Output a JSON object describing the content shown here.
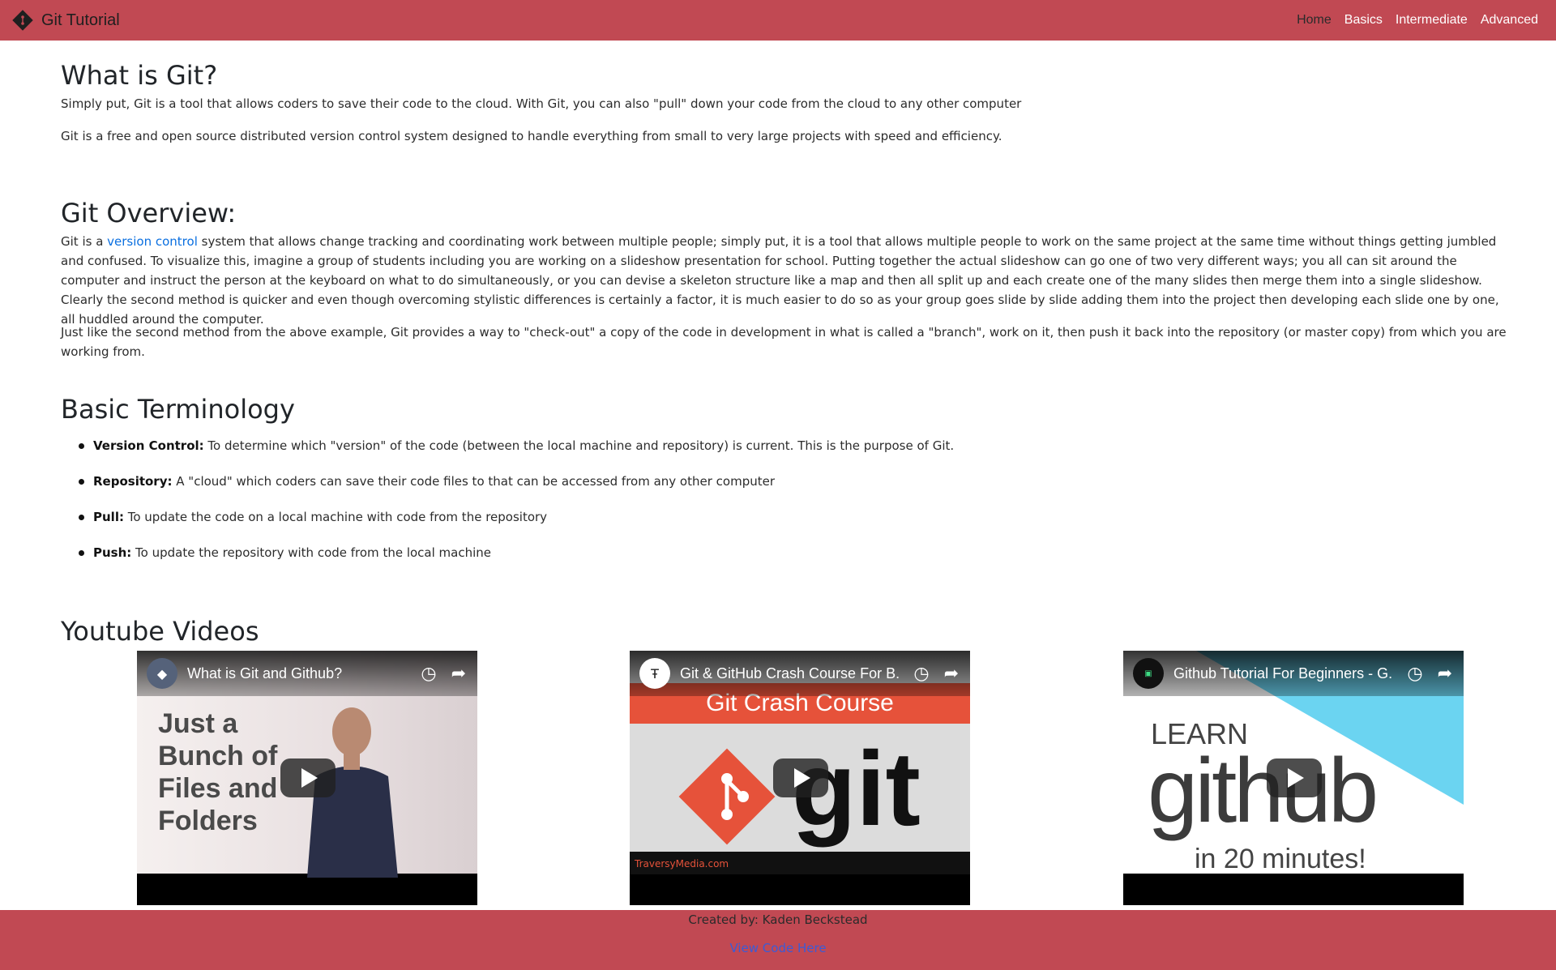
{
  "nav": {
    "brand": "Git Tutorial",
    "links": [
      "Home",
      "Basics",
      "Intermediate",
      "Advanced"
    ]
  },
  "section1": {
    "title": "What is Git?",
    "p1": "Simply put, Git is a tool that allows coders to save their code to the cloud. With Git, you can also \"pull\" down your code from the cloud to any other computer",
    "p2": "Git is a free and open source distributed version control system designed to handle everything from small to very large projects with speed and efficiency."
  },
  "section2": {
    "title": "Git Overview:",
    "p1_before": "Git is a ",
    "p1_link": "version control",
    "p1_after": " system that allows change tracking and coordinating work between multiple people; simply put, it is a tool that allows multiple people to work on the same project at the same time without things getting jumbled and confused. To visualize this, imagine a group of students including you are working on a slideshow presentation for school. Putting together the actual slideshow can go one of two very different ways; you all can sit around the computer and instruct the person at the keyboard on what to do simultaneously, or you can devise a skeleton structure like a map and then all split up and each create one of the many slides then merge them into a single slideshow. Clearly the second method is quicker and even though overcoming stylistic differences is certainly a factor, it is much easier to do so as your group goes slide by slide adding them into the project then developing each slide one by one, all huddled around the computer.",
    "p2": "Just like the second method from the above example, Git provides a way to \"check-out\" a copy of the code in development in what is called a \"branch\", work on it, then push it back into the repository (or master copy) from which you are working from."
  },
  "section3": {
    "title": "Basic Terminology",
    "terms": [
      {
        "term": "Version Control:",
        "desc": " To determine which \"version\" of the code (between the local machine and repository) is current. This is the purpose of Git."
      },
      {
        "term": "Repository:",
        "desc": " A \"cloud\" which coders can save their code files to that can be accessed from any other computer"
      },
      {
        "term": "Pull:",
        "desc": " To update the code on a local machine with code from the repository"
      },
      {
        "term": "Push:",
        "desc": " To update the repository with code from the local machine"
      }
    ]
  },
  "section4": {
    "title": "Youtube Videos",
    "videos": [
      {
        "title": "What is Git and Github?",
        "thumb_text": "Just a Bunch of Files and Folders"
      },
      {
        "title": "Git & GitHub Crash Course For B...",
        "banner": "Git Crash Course",
        "logo_text": "git",
        "footer": "TraversyMedia.com"
      },
      {
        "title": "Github Tutorial For Beginners - G...",
        "learn": "LEARN",
        "github": "github",
        "mins": "in 20 minutes!"
      }
    ]
  },
  "footer": {
    "credit": "Created by: Kaden Beckstead",
    "link": "View Code Here"
  },
  "colors": {
    "accent": "#c14953",
    "link": "#0a6fe0"
  }
}
